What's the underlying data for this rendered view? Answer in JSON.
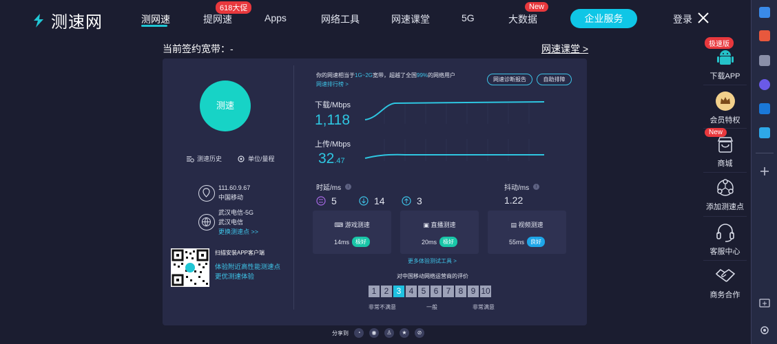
{
  "header": {
    "logo_text": "测速网",
    "nav": [
      {
        "label": "测网速"
      },
      {
        "label": "提网速",
        "badge": "618大促"
      },
      {
        "label": "Apps"
      },
      {
        "label": "网络工具"
      },
      {
        "label": "网速课堂"
      },
      {
        "label": "5G"
      },
      {
        "label": "大数据",
        "badge": "New"
      }
    ],
    "enterprise_button": "企业服务",
    "login": "登录"
  },
  "subheader": {
    "contract": "当前签约宽带：-",
    "course_link": "网速课堂 >"
  },
  "left_panel": {
    "speed_button": "测速",
    "history_link": "测速历史",
    "unit_link": "单位/量程",
    "ip": "111.60.9.67",
    "isp": "中国移动",
    "node_line1": "武汉电信-5G",
    "node_line2": "武汉电信",
    "change_node": "更换测速点 >>",
    "qr_title": "扫描安装APP客户端",
    "qr_line1": "体验附近高性能测速点",
    "qr_line2": "更优测速体验"
  },
  "right_panel": {
    "desc_prefix": "你的网速相当于",
    "desc_range": "1G~2G",
    "desc_mid": "宽带，超越了全国",
    "desc_pct": "99%",
    "desc_suffix": "的网络用户",
    "rank_link": "网速排行榜 >",
    "diag_button": "网速诊断报告",
    "self_check_button": "自助排障",
    "download_label": "下载/Mbps",
    "download_value": "1,118",
    "upload_label": "上传/Mbps",
    "upload_int": "32",
    "upload_dec": ".47",
    "latency_label": "时延/ms",
    "latency_values": [
      "5",
      "14",
      "3"
    ],
    "jitter_label": "抖动/ms",
    "jitter_value": "1.22",
    "tests": [
      {
        "title": "游戏测速",
        "ms": "14ms",
        "badge": "极好"
      },
      {
        "title": "直播测速",
        "ms": "20ms",
        "badge": "极好"
      },
      {
        "title": "视频测速",
        "ms": "55ms",
        "badge": "良好"
      }
    ],
    "more_tests": "更多体验测试工具 >",
    "rating_title": "对中国移动网络运营商的评价",
    "rating_scale": [
      "1",
      "2",
      "3",
      "4",
      "5",
      "6",
      "7",
      "8",
      "9",
      "10"
    ],
    "rating_selected": 3,
    "rating_low": "非常不满意",
    "rating_mid": "一般",
    "rating_high": "非常满意",
    "share_label": "分享到"
  },
  "float_bar": [
    {
      "label": "下载APP",
      "badge": "极速版"
    },
    {
      "label": "会员特权"
    },
    {
      "label": "商城",
      "badge": "New"
    },
    {
      "label": "添加测速点"
    },
    {
      "label": "客服中心"
    },
    {
      "label": "商务合作"
    }
  ],
  "colors": {
    "accent": "#21c6d4",
    "background": "#1b1d30",
    "panel": "#272a47",
    "badge_red": "#e8383d"
  }
}
